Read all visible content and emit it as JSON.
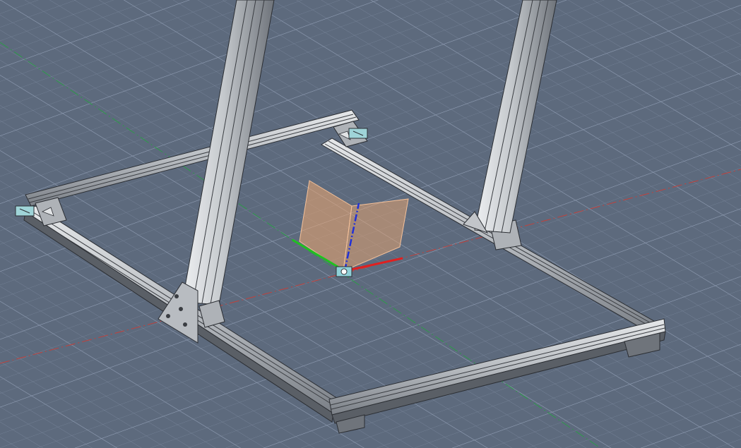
{
  "viewport": {
    "background": "#5d6a7d",
    "grid_color": "#7d8aa0",
    "grid_major_color": "#8e9bb1",
    "axis_x_color": "#c0413c",
    "axis_y_color": "#2e9a4a",
    "axis_z_color": "#2030d8",
    "extrusion_color": "#c9cccf",
    "extrusion_dark": "#3a3d42",
    "plane_color": "#f0a870"
  },
  "scene": {
    "object": "aluminum-extrusion-frame",
    "uprights": 2,
    "base_rails": 4
  }
}
